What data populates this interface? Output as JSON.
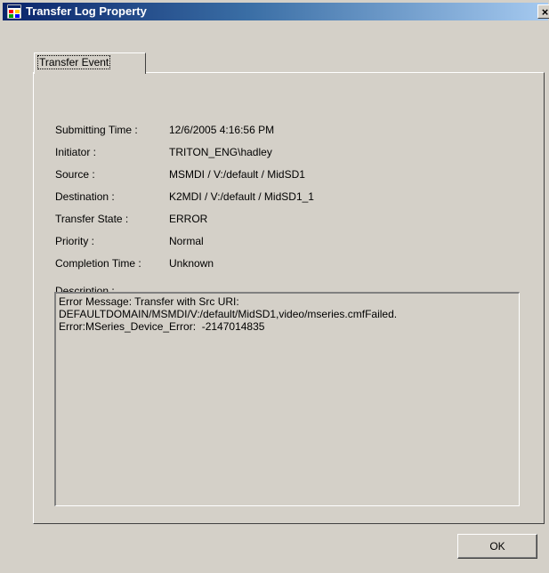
{
  "window": {
    "title": "Transfer Log Property",
    "icon": "app-window-icon",
    "close_glyph": "×"
  },
  "tabs": [
    {
      "label": "Transfer Event",
      "active": true
    }
  ],
  "properties": [
    {
      "label": "Submitting Time :",
      "value": "12/6/2005 4:16:56 PM"
    },
    {
      "label": "Initiator :",
      "value": "TRITON_ENG\\hadley"
    },
    {
      "label": "Source :",
      "value": "MSMDI / V:/default / MidSD1"
    },
    {
      "label": "Destination :",
      "value": "K2MDI / V:/default / MidSD1_1"
    },
    {
      "label": "Transfer State :",
      "value": "ERROR"
    },
    {
      "label": "Priority :",
      "value": "Normal"
    },
    {
      "label": "Completion Time :",
      "value": "Unknown"
    }
  ],
  "description": {
    "label": "Description :",
    "text": "Error Message: Transfer with Src URI:\nDEFAULTDOMAIN/MSMDI/V:/default/MidSD1,video/mseries.cmfFailed.\nError:MSeries_Device_Error:  -2147014835"
  },
  "buttons": {
    "ok_label": "OK"
  },
  "colors": {
    "face": "#d4d0c8",
    "titlebar_start": "#0a246a",
    "titlebar_end": "#a6caf0"
  }
}
